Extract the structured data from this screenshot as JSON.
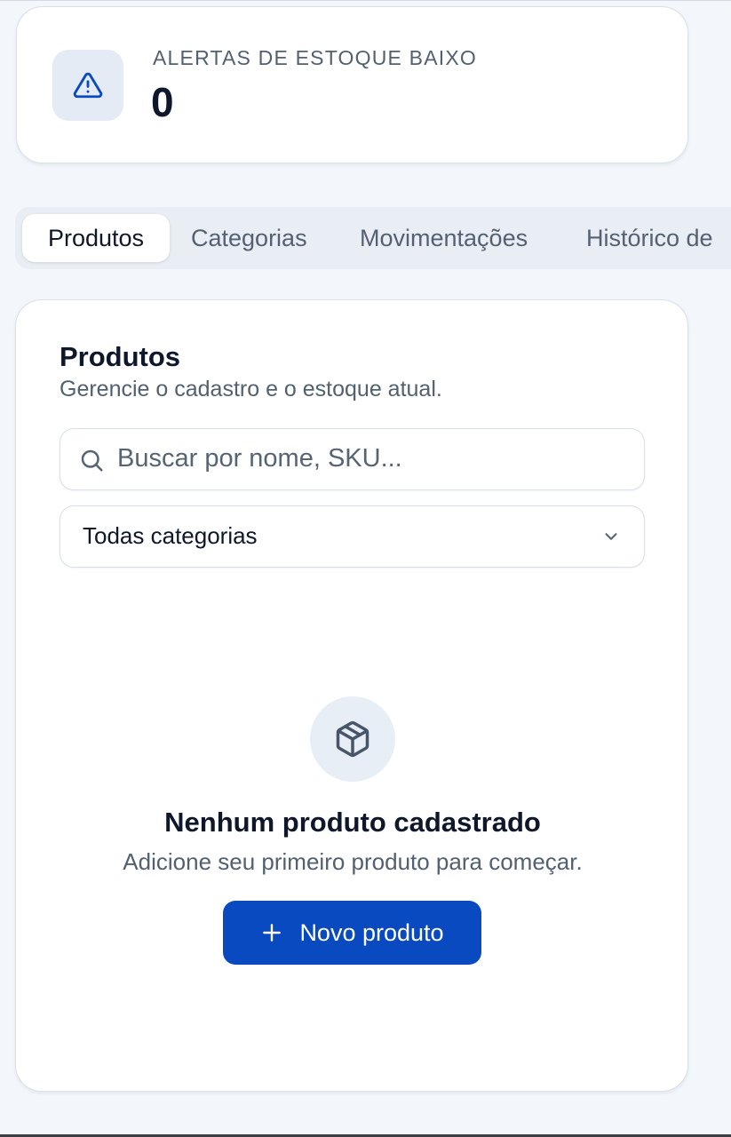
{
  "alert": {
    "label": "ALERTAS DE ESTOQUE BAIXO",
    "count": "0",
    "icon": "alert-triangle-icon"
  },
  "tabs": [
    {
      "label": "Produtos",
      "active": true
    },
    {
      "label": "Categorias",
      "active": false
    },
    {
      "label": "Movimentações",
      "active": false
    },
    {
      "label": "Histórico de",
      "active": false
    }
  ],
  "products": {
    "title": "Produtos",
    "subtitle": "Gerencie o cadastro e o estoque atual.",
    "search": {
      "placeholder": "Buscar por nome, SKU...",
      "value": ""
    },
    "category_select": {
      "selected": "Todas categorias"
    },
    "empty_state": {
      "icon": "package-icon",
      "title": "Nenhum produto cadastrado",
      "subtitle": "Adicione seu primeiro produto para começar.",
      "button_label": "Novo produto"
    }
  },
  "colors": {
    "background": "#f3f7fb",
    "primary": "#0a4ac0",
    "alert_icon": "#0a4ac0",
    "text_primary": "#0f172a",
    "text_secondary": "#526070"
  }
}
